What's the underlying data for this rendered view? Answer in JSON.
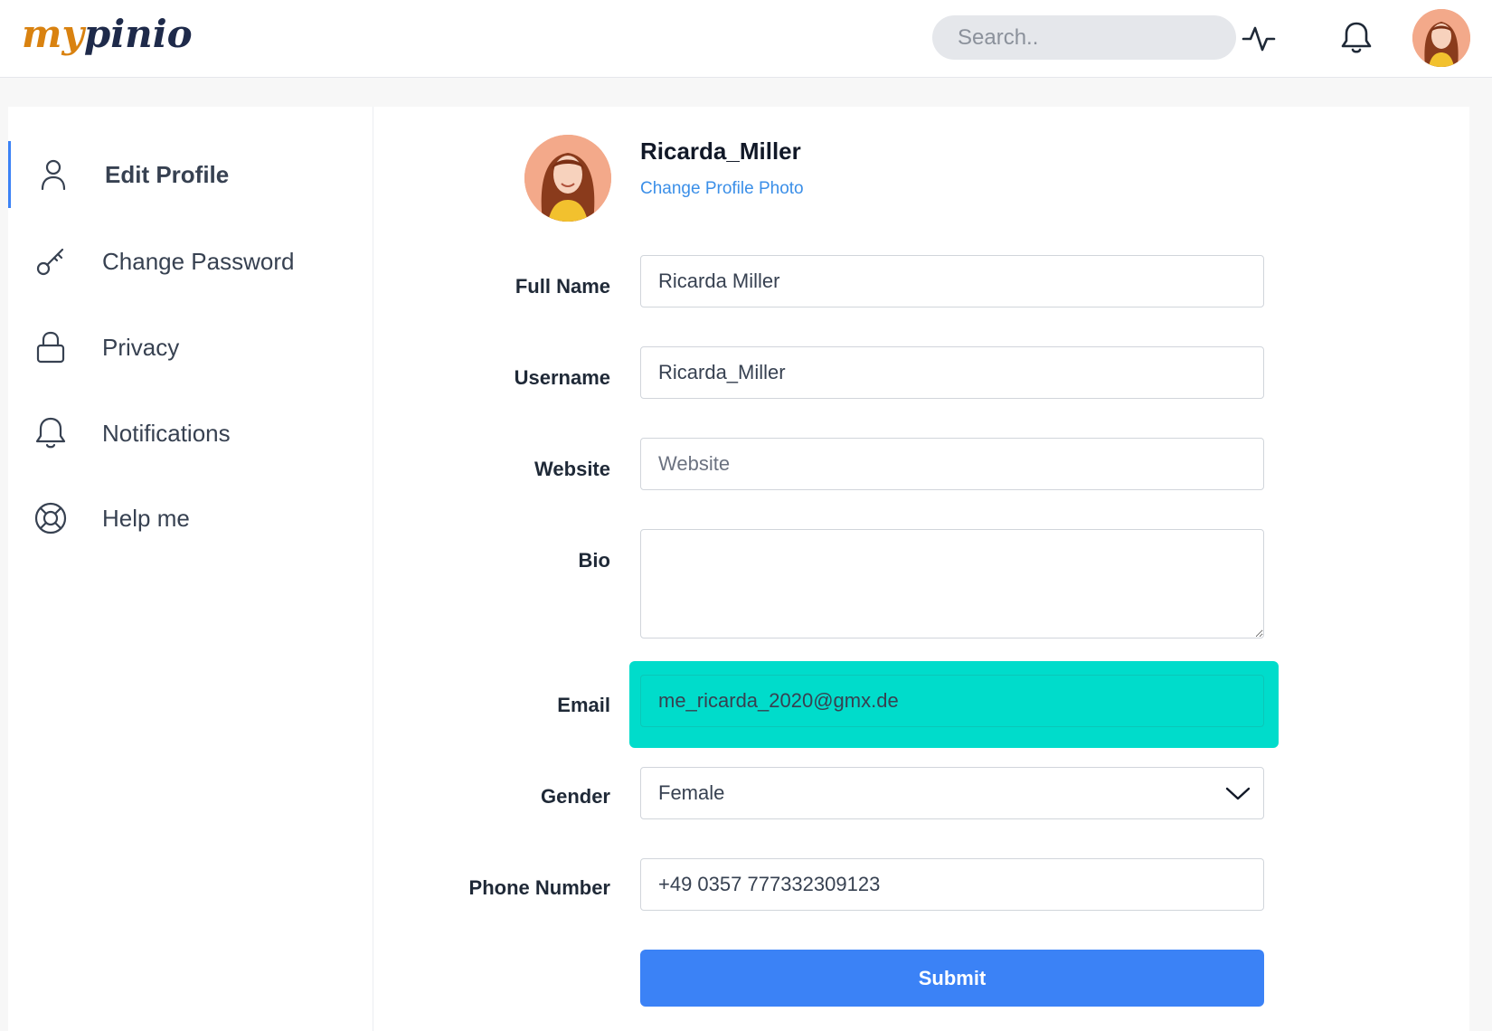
{
  "header": {
    "logo_part1": "my",
    "logo_part2": "pinio",
    "search_placeholder": "Search..",
    "icons": [
      "activity-icon",
      "bell-icon"
    ]
  },
  "sidebar": {
    "items": [
      {
        "label": "Edit Profile",
        "icon": "user-icon",
        "active": true
      },
      {
        "label": "Change Password",
        "icon": "key-icon"
      },
      {
        "label": "Privacy",
        "icon": "lock-icon"
      },
      {
        "label": "Notifications",
        "icon": "bell-icon"
      },
      {
        "label": "Help me",
        "icon": "lifebuoy-icon"
      }
    ]
  },
  "profile": {
    "username": "Ricarda_Miller",
    "change_photo_label": "Change Profile Photo"
  },
  "form": {
    "full_name": {
      "label": "Full Name",
      "value": "Ricarda Miller"
    },
    "username": {
      "label": "Username",
      "value": "Ricarda_Miller"
    },
    "website": {
      "label": "Website",
      "value": "",
      "placeholder": "Website"
    },
    "bio": {
      "label": "Bio",
      "value": ""
    },
    "email": {
      "label": "Email",
      "value": "me_ricarda_2020@gmx.de"
    },
    "gender": {
      "label": "Gender",
      "value": "Female"
    },
    "phone": {
      "label": "Phone Number",
      "value": "+49 0357 777332309123"
    },
    "submit_label": "Submit"
  },
  "colors": {
    "accent": "#3b82f6",
    "highlight": "#00dccb",
    "logo_orange": "#d98210",
    "logo_navy": "#1e2a4a"
  }
}
